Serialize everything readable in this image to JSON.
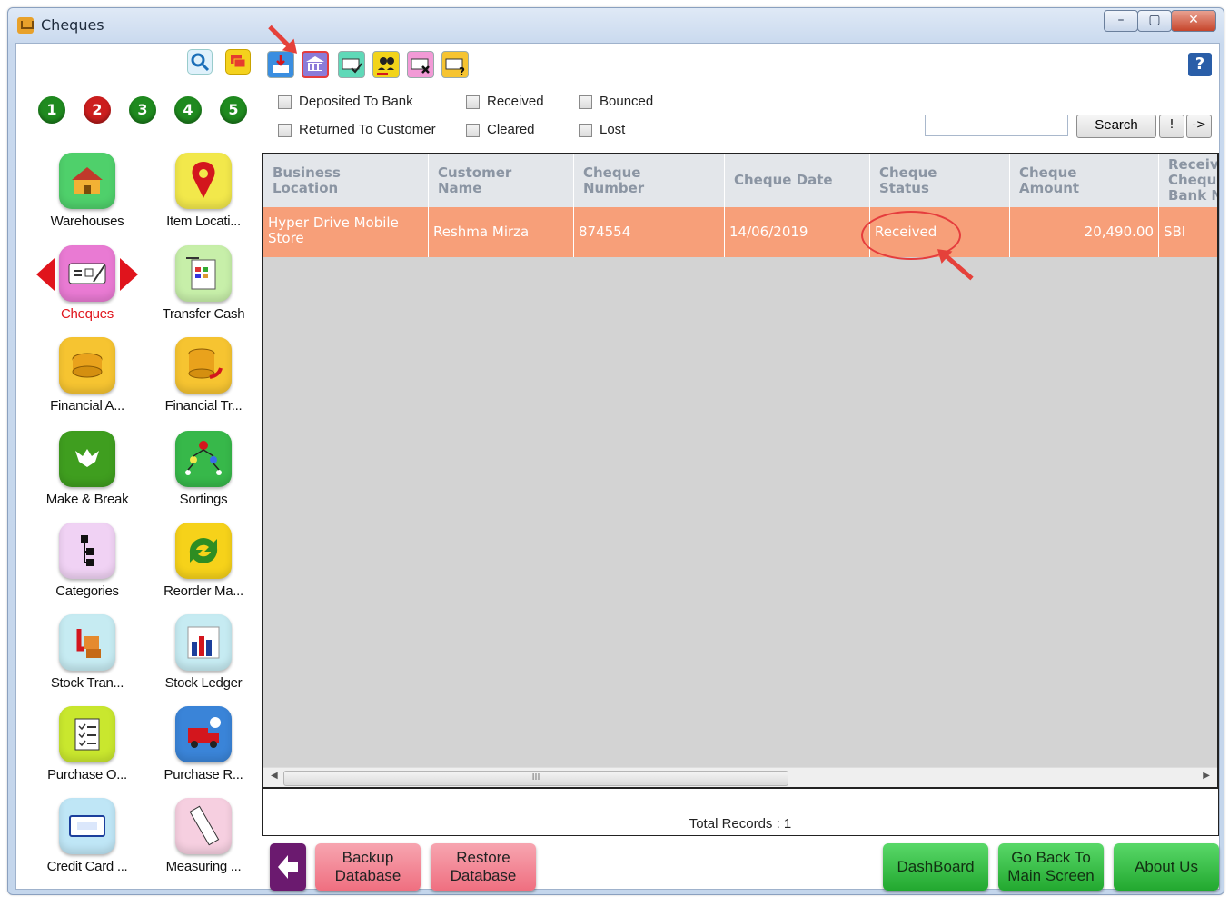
{
  "window": {
    "title": "Cheques",
    "minimize_glyph": "–",
    "maximize_glyph": "▢",
    "close_glyph": "✕"
  },
  "sidebar": {
    "numbers": [
      "1",
      "2",
      "3",
      "4",
      "5"
    ],
    "tiles": [
      {
        "label": "Warehouses",
        "icon": "warehouse-icon"
      },
      {
        "label": "Item Locati...",
        "icon": "location-pin-icon"
      },
      {
        "label": "Cheques",
        "icon": "cheque-icon"
      },
      {
        "label": "Transfer Cash",
        "icon": "transfer-cash-icon"
      },
      {
        "label": "Financial A...",
        "icon": "coins-icon"
      },
      {
        "label": "Financial Tr...",
        "icon": "coins-transfer-icon"
      },
      {
        "label": "Make & Break",
        "icon": "make-break-icon"
      },
      {
        "label": "Sortings",
        "icon": "sorting-tree-icon"
      },
      {
        "label": "Categories",
        "icon": "categories-icon"
      },
      {
        "label": "Reorder Ma...",
        "icon": "reorder-icon"
      },
      {
        "label": "Stock Tran...",
        "icon": "stock-transfer-icon"
      },
      {
        "label": "Stock Ledger",
        "icon": "bar-chart-icon"
      },
      {
        "label": "Purchase O...",
        "icon": "checklist-icon"
      },
      {
        "label": "Purchase R...",
        "icon": "truck-icon"
      },
      {
        "label": "Credit Card ...",
        "icon": "credit-card-icon"
      },
      {
        "label": "Measuring ...",
        "icon": "ruler-icon"
      }
    ]
  },
  "toolbar": {
    "help": "?"
  },
  "filters": {
    "deposited_to_bank": "Deposited To Bank",
    "received": "Received",
    "bounced": "Bounced",
    "returned_to_customer": "Returned To Customer",
    "cleared": "Cleared",
    "lost": "Lost"
  },
  "search": {
    "value": "",
    "button": "Search",
    "exclaim": "!",
    "next": "->"
  },
  "grid": {
    "columns": [
      "Business\nLocation",
      "Customer\nName",
      "Cheque\nNumber",
      "Cheque Date",
      "Cheque\nStatus",
      "Cheque\nAmount",
      "Receive\nCheque\nBank N"
    ],
    "rows": [
      {
        "business_location": "Hyper Drive Mobile\nStore",
        "customer_name": "Reshma Mirza",
        "cheque_number": "874554",
        "cheque_date": "14/06/2019",
        "cheque_status": "Received",
        "cheque_amount": "20,490.00",
        "bank": "SBI"
      }
    ],
    "scroll_grip": "III"
  },
  "footer": {
    "total_records": "Total Records : 1",
    "backup": "Backup\nDatabase",
    "restore": "Restore\nDatabase",
    "dashboard": "DashBoard",
    "go_back": "Go Back To\nMain Screen",
    "about": "About Us"
  },
  "colors": {
    "selected_row": "#f79f79",
    "accent_red": "#e0141c",
    "header_text": "#8b95a3"
  }
}
